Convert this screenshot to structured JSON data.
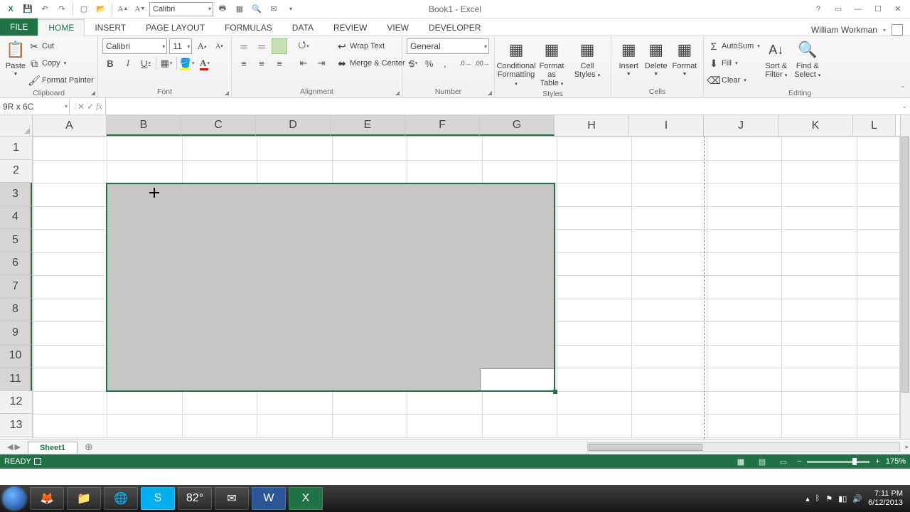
{
  "title": "Book1 - Excel",
  "qat": {
    "font": "Calibri"
  },
  "user": "William Workman",
  "tabs": {
    "file": "FILE",
    "home": "HOME",
    "insert": "INSERT",
    "pagelayout": "PAGE LAYOUT",
    "formulas": "FORMULAS",
    "data": "DATA",
    "review": "REVIEW",
    "view": "VIEW",
    "developer": "DEVELOPER"
  },
  "clipboard": {
    "cut": "Cut",
    "copy": "Copy",
    "fp": "Format Painter",
    "paste": "Paste",
    "label": "Clipboard"
  },
  "font": {
    "name": "Calibri",
    "size": "11",
    "label": "Font"
  },
  "alignment": {
    "wrap": "Wrap Text",
    "merge": "Merge & Center",
    "label": "Alignment"
  },
  "number": {
    "format": "General",
    "label": "Number"
  },
  "styles": {
    "cond": "Conditional",
    "cond2": "Formatting",
    "fat": "Format as",
    "fat2": "Table",
    "cell": "Cell",
    "cell2": "Styles",
    "label": "Styles"
  },
  "cells": {
    "insert": "Insert",
    "delete": "Delete",
    "format": "Format",
    "label": "Cells"
  },
  "editing": {
    "autosum": "AutoSum",
    "fill": "Fill",
    "clear": "Clear",
    "sort": "Sort &",
    "sort2": "Filter",
    "find": "Find &",
    "find2": "Select",
    "label": "Editing"
  },
  "namebox": "9R x 6C",
  "columns": [
    "A",
    "B",
    "C",
    "D",
    "E",
    "F",
    "G",
    "H",
    "I",
    "J",
    "K",
    "L"
  ],
  "rows": [
    "1",
    "2",
    "3",
    "4",
    "5",
    "6",
    "7",
    "8",
    "9",
    "10",
    "11",
    "12",
    "13"
  ],
  "sheet": "Sheet1",
  "status": "READY",
  "zoom": "175%",
  "taskbar": {
    "temp": "82°",
    "time": "7:11 PM",
    "date": "6/12/2013"
  }
}
